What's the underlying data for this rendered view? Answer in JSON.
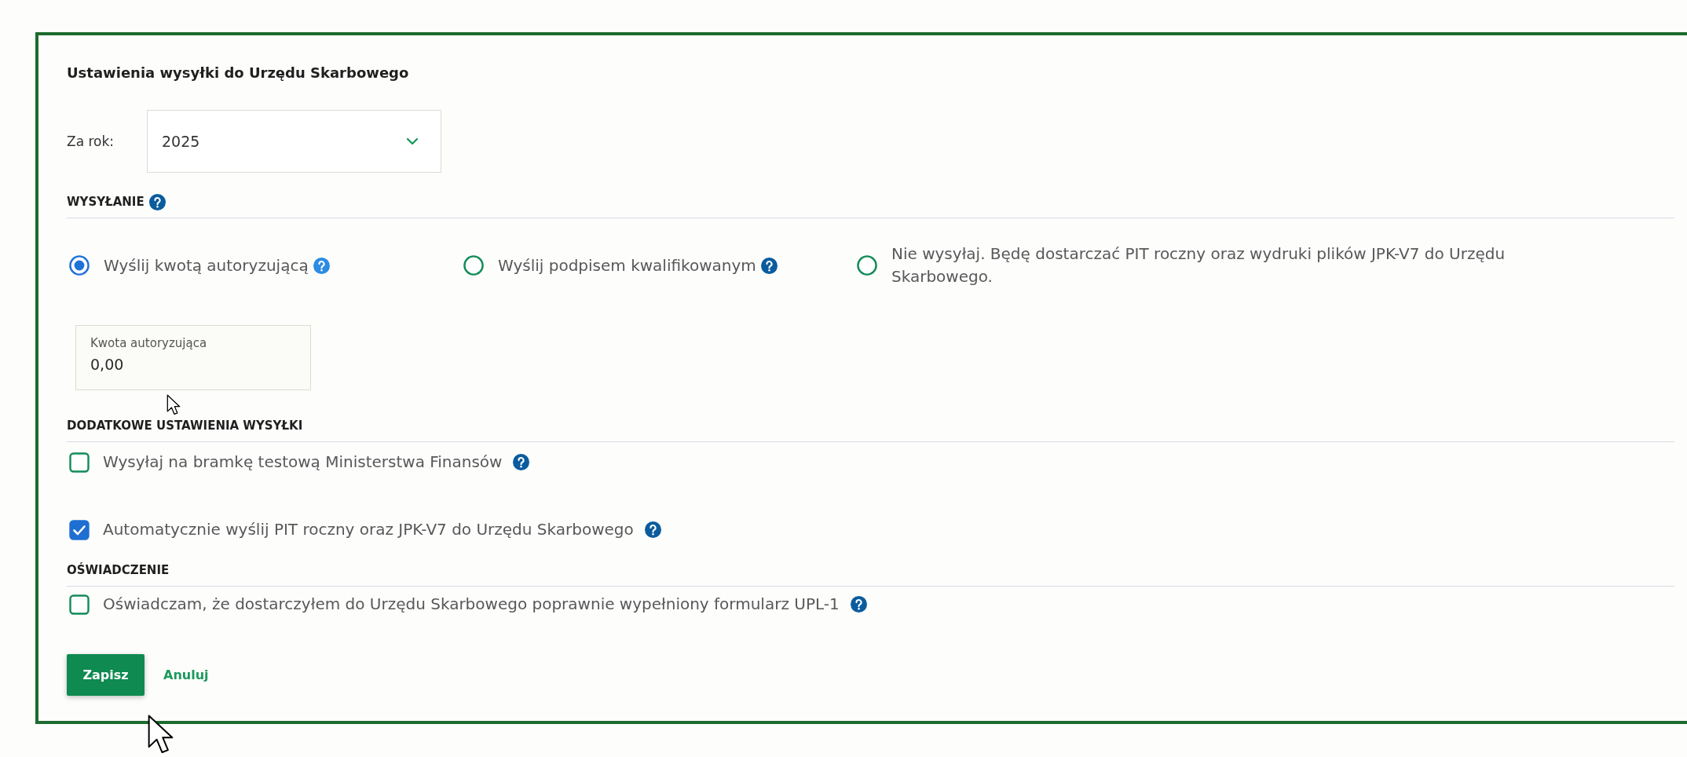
{
  "title": "Ustawienia wysyłki do Urzędu Skarbowego",
  "year_select": {
    "label": "Za rok:",
    "value": "2025"
  },
  "sections": [
    {
      "heading": "WYSYŁANIE",
      "help": true,
      "kind": "radios",
      "options": [
        {
          "label": "Wyślij kwotą autoryzującą",
          "selected": true,
          "help": true
        },
        {
          "label": "Wyślij podpisem kwalifikowanym",
          "selected": false,
          "help": true
        },
        {
          "label": "Nie wysyłaj. Będę dostarczać PIT roczny oraz wydruki plików JPK-V7 do Urzędu Skarbowego.",
          "selected": false,
          "help": false
        }
      ],
      "field": {
        "label": "Kwota autoryzująca",
        "value": "0,00"
      }
    },
    {
      "heading": "DODATKOWE USTAWIENIA WYSYŁKI",
      "help": false,
      "kind": "checkboxes",
      "options": [
        {
          "label": "Wysyłaj na bramkę testową Ministerstwa Finansów",
          "checked": false,
          "help": true
        },
        {
          "label": "Automatycznie wyślij PIT roczny oraz JPK-V7 do Urzędu Skarbowego",
          "checked": true,
          "help": true
        }
      ]
    },
    {
      "heading": "OŚWIADCZENIE",
      "help": false,
      "kind": "checkboxes",
      "options": [
        {
          "label": "Oświadczam, że dostarczyłem do Urzędu Skarbowego poprawnie wypełniony formularz UPL-1",
          "checked": false,
          "help": true
        }
      ]
    }
  ],
  "buttons": [
    {
      "label": "Zapisz",
      "kind": "primary"
    },
    {
      "label": "Anuluj",
      "kind": "link"
    }
  ]
}
